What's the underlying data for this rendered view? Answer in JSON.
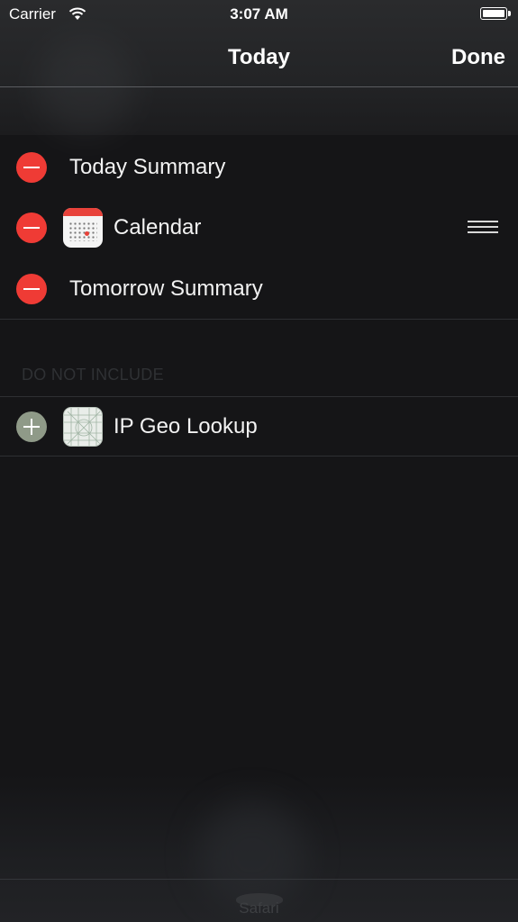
{
  "status_bar": {
    "carrier": "Carrier",
    "time": "3:07 AM"
  },
  "nav": {
    "title": "Today",
    "done_label": "Done"
  },
  "included_widgets": [
    {
      "label": "Today Summary",
      "icon": null
    },
    {
      "label": "Calendar",
      "icon": "calendar-app-icon"
    },
    {
      "label": "Tomorrow Summary",
      "icon": null
    }
  ],
  "do_not_include": {
    "header": "DO NOT INCLUDE",
    "items": [
      {
        "label": "IP Geo Lookup",
        "icon": "ip-geo-lookup-app-icon"
      }
    ]
  },
  "dock": {
    "label": "Safari"
  },
  "colors": {
    "remove": "#ef3b35",
    "add": "#8f9a88",
    "background": "#151517"
  }
}
